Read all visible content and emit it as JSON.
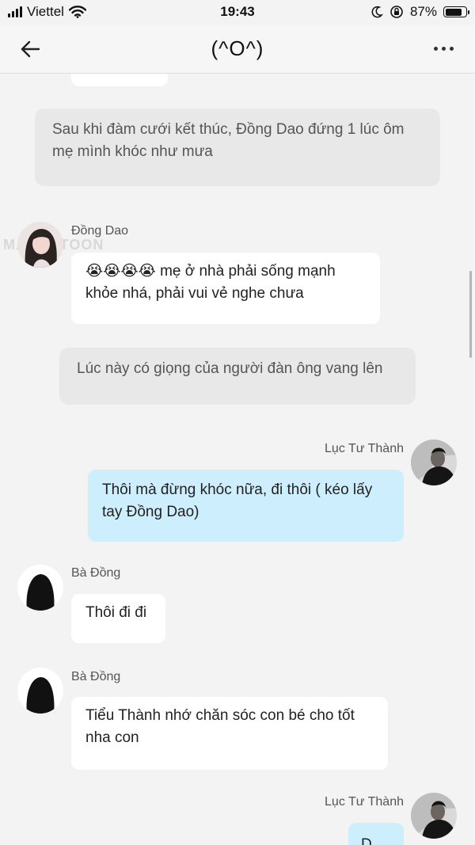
{
  "status_bar": {
    "carrier": "Viettel",
    "time": "19:43",
    "battery": "87%",
    "battery_level": 0.87
  },
  "header": {
    "title": "(^O^)"
  },
  "watermark": "MANGATOON",
  "messages": [
    {
      "type": "narration",
      "text": "Sau khi đàm cưới kết thúc, Đồng Dao đứng 1 lúc ôm mẹ mình khóc như mưa"
    },
    {
      "type": "left",
      "name": "Đồng Dao",
      "text": "😭😭😭😭 mẹ ở nhà phải sống mạnh khỏe nhá, phải vui vẻ nghe chưa"
    },
    {
      "type": "narration",
      "text": "Lúc này có giọng của người đàn ông vang lên"
    },
    {
      "type": "right",
      "name": "Lục Tư Thành",
      "text": "Thôi mà đừng khóc nữa, đi thôi ( kéo lấy tay Đồng Dao)"
    },
    {
      "type": "left",
      "name": "Bà Đồng",
      "text": "Thôi đi đi"
    },
    {
      "type": "left",
      "name": "Bà Đồng",
      "text": "Tiểu Thành nhớ chăn sóc con bé cho tốt nha con"
    },
    {
      "type": "right",
      "name": "Lục Tư Thành",
      "text": "D..."
    }
  ]
}
